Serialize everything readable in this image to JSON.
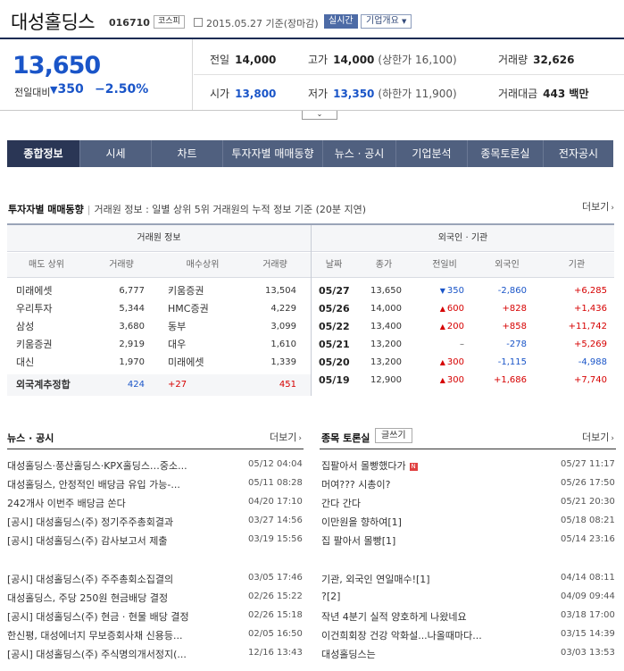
{
  "header": {
    "company": "대성홀딩스",
    "code": "016710",
    "market": "코스피",
    "date_text": "2015.05.27 기준(장마감)",
    "realtime_label": "실시간",
    "overview_label": "기업개요"
  },
  "price": {
    "current": "13,650",
    "prev_label": "전일대비",
    "change": "350",
    "change_pct": "−2.50%",
    "prev_close_label": "전일",
    "prev_close": "14,000",
    "high_label": "고가",
    "high": "14,000",
    "upper_limit_label": "상한가",
    "upper_limit": "16,100",
    "volume_label": "거래량",
    "volume": "32,626",
    "open_label": "시가",
    "open": "13,800",
    "low_label": "저가",
    "low": "13,350",
    "lower_limit_label": "하한가",
    "lower_limit": "11,900",
    "amount_label": "거래대금",
    "amount": "443 백만"
  },
  "tabs": [
    "종합정보",
    "시세",
    "차트",
    "투자자별 매매동향",
    "뉴스 · 공시",
    "기업분석",
    "종목토론실",
    "전자공시"
  ],
  "investor": {
    "title": "투자자별 매매동향",
    "desc": "거래원 정보 : 일별 상위 5위 거래원의 누적 정보 기준 (20분 지연)",
    "more": "더보기",
    "broker_header": "거래원 정보",
    "foreign_header": "외국인 · 기관",
    "cols": [
      "매도 상위",
      "거래량",
      "매수상위",
      "거래량",
      "날짜",
      "종가",
      "전일비",
      "외국인",
      "기관"
    ],
    "brokers": [
      {
        "sell": "미래에셋",
        "sell_vol": "6,777",
        "buy": "키움증권",
        "buy_vol": "13,504"
      },
      {
        "sell": "우리투자",
        "sell_vol": "5,344",
        "buy": "HMC증권",
        "buy_vol": "4,229"
      },
      {
        "sell": "삼성",
        "sell_vol": "3,680",
        "buy": "동부",
        "buy_vol": "3,099"
      },
      {
        "sell": "키움증권",
        "sell_vol": "2,919",
        "buy": "대우",
        "buy_vol": "1,610"
      },
      {
        "sell": "대신",
        "sell_vol": "1,970",
        "buy": "미래에셋",
        "buy_vol": "1,339"
      }
    ],
    "foreign_est": {
      "label": "외국계추정합",
      "sell": "424",
      "diff": "+27",
      "buy": "451"
    },
    "daily": [
      {
        "date": "05/27",
        "close": "13,650",
        "dir": "down",
        "diff": "350",
        "foreign": "-2,860",
        "inst": "+6,285"
      },
      {
        "date": "05/26",
        "close": "14,000",
        "dir": "up",
        "diff": "600",
        "foreign": "+828",
        "inst": "+1,436"
      },
      {
        "date": "05/22",
        "close": "13,400",
        "dir": "up",
        "diff": "200",
        "foreign": "+858",
        "inst": "+11,742"
      },
      {
        "date": "05/21",
        "close": "13,200",
        "dir": "flat",
        "diff": "–",
        "foreign": "-278",
        "inst": "+5,269"
      },
      {
        "date": "05/20",
        "close": "13,200",
        "dir": "up",
        "diff": "300",
        "foreign": "-1,115",
        "inst": "-4,988"
      },
      {
        "date": "05/19",
        "close": "12,900",
        "dir": "up",
        "diff": "300",
        "foreign": "+1,686",
        "inst": "+7,740"
      }
    ]
  },
  "news": {
    "title": "뉴스 · 공시",
    "more": "더보기",
    "items": [
      {
        "text": "대성홀딩스·풍산홀딩스·KPX홀딩스…중소...",
        "date": "05/12 04:04"
      },
      {
        "text": "대성홀딩스, 안정적인 배당금 유입 가능-...",
        "date": "05/11 08:28"
      },
      {
        "text": "242개사 이번주 배당금 쏜다",
        "date": "04/20 17:10"
      },
      {
        "text": "[공시] 대성홀딩스(주) 정기주주총회결과",
        "date": "03/27 14:56"
      },
      {
        "text": "[공시] 대성홀딩스(주) 감사보고서 제출",
        "date": "03/19 15:56"
      },
      {
        "text": "[공시] 대성홀딩스(주) 주주총회소집결의",
        "date": "03/05 17:46"
      },
      {
        "text": "대성홀딩스, 주당 250원 현금배당 결정",
        "date": "02/26 15:22"
      },
      {
        "text": "[공시] 대성홀딩스(주) 현금 · 현물 배당 결정",
        "date": "02/26 15:18"
      },
      {
        "text": "한신평, 대성에너지 무보증회사채 신용등...",
        "date": "02/05 16:50"
      },
      {
        "text": "[공시] 대성홀딩스(주) 주식명의개서정지(...",
        "date": "12/16 13:43"
      }
    ]
  },
  "forum": {
    "title": "종목 토론실",
    "write_label": "글쓰기",
    "more": "더보기",
    "new_badge": "N",
    "items": [
      {
        "text": "집팔아서 몰빵했다가",
        "date": "05/27 11:17",
        "new": true
      },
      {
        "text": "머여??? 시총이?",
        "date": "05/26 17:50"
      },
      {
        "text": "간다 간다",
        "date": "05/21 20:30"
      },
      {
        "text": "이만원을 향하여[1]",
        "date": "05/18 08:21"
      },
      {
        "text": "집 팔아서 몰빵[1]",
        "date": "05/14 23:16"
      },
      {
        "text": "기관, 외국인 연일매수![1]",
        "date": "04/14 08:11"
      },
      {
        "text": "?[2]",
        "date": "04/09 09:44"
      },
      {
        "text": "작년 4분기 실적 양호하게 나왔네요",
        "date": "03/18 17:00"
      },
      {
        "text": "이건희회장 건강 악화설...나올때마다...",
        "date": "03/15 14:39"
      },
      {
        "text": "대성홀딩스는",
        "date": "03/03 13:53"
      }
    ]
  }
}
